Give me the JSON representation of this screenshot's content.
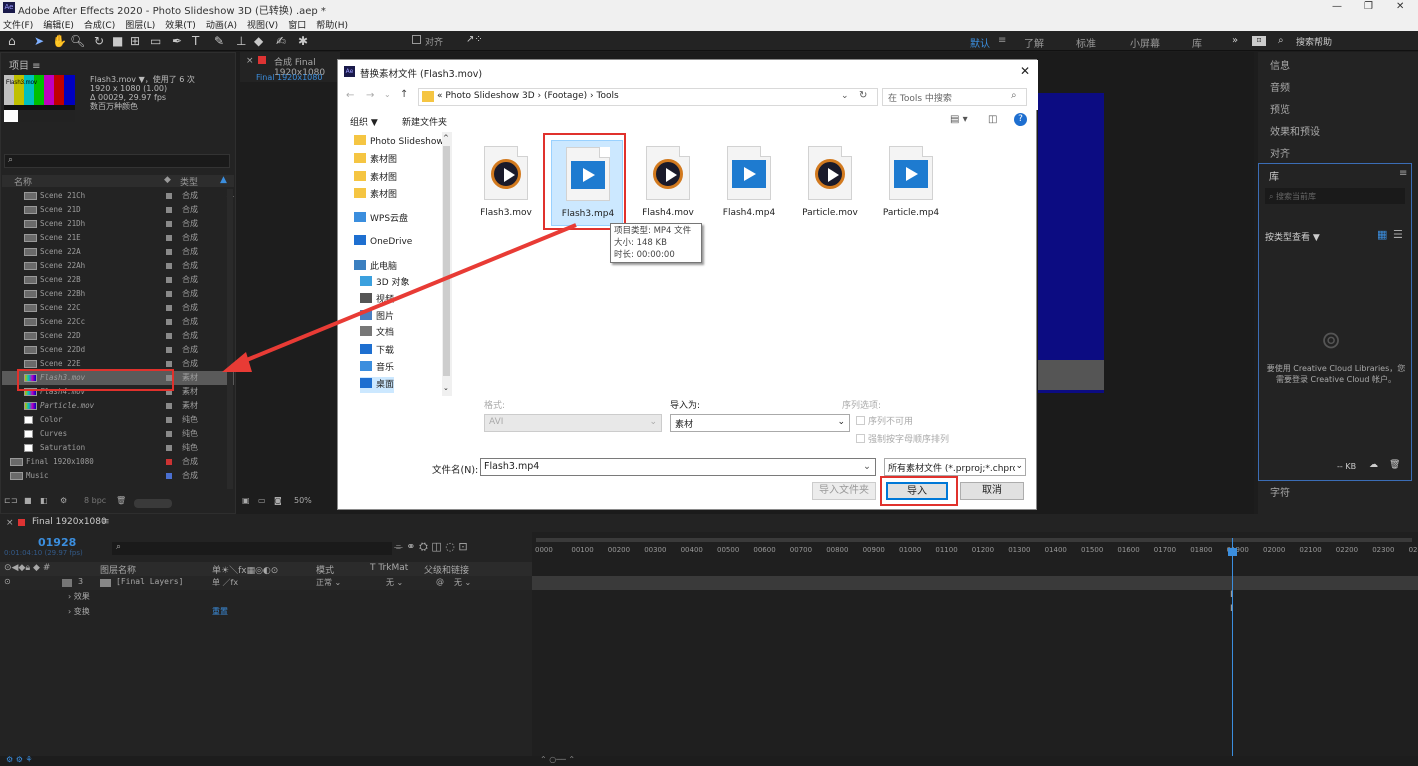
{
  "app": {
    "title": "Adobe After Effects 2020 - Photo Slideshow 3D (已转换) .aep *",
    "logo": "Ae"
  },
  "menu": [
    "文件(F)",
    "编辑(E)",
    "合成(C)",
    "图层(L)",
    "效果(T)",
    "动画(A)",
    "视图(V)",
    "窗口",
    "帮助(H)"
  ],
  "toolbar": {
    "align_label": "对齐",
    "workspaces": [
      "默认",
      "了解",
      "标准",
      "小屏幕",
      "库"
    ],
    "workspace_active": "默认",
    "search_help": "搜索帮助"
  },
  "project": {
    "title": "项目",
    "selected_name": "Flash3.mov",
    "selected_info": [
      "Flash3.mov ▼，使用了 6 次",
      "1920 x 1080 (1.00)",
      "Δ 00029, 29.97 fps",
      "数百万种颜色"
    ],
    "col_name": "名称",
    "col_type": "类型",
    "bpc": "8 bpc",
    "rows": [
      {
        "name": "Scene 21Ch",
        "type": "合成"
      },
      {
        "name": "Scene 21D",
        "type": "合成"
      },
      {
        "name": "Scene 21Dh",
        "type": "合成"
      },
      {
        "name": "Scene 21E",
        "type": "合成"
      },
      {
        "name": "Scene 22A",
        "type": "合成"
      },
      {
        "name": "Scene 22Ah",
        "type": "合成"
      },
      {
        "name": "Scene 22B",
        "type": "合成"
      },
      {
        "name": "Scene 22Bh",
        "type": "合成"
      },
      {
        "name": "Scene 22C",
        "type": "合成"
      },
      {
        "name": "Scene 22Cc",
        "type": "合成"
      },
      {
        "name": "Scene 22D",
        "type": "合成"
      },
      {
        "name": "Scene 22Dd",
        "type": "合成"
      },
      {
        "name": "Scene 22E",
        "type": "合成"
      },
      {
        "name": "Flash3.mov",
        "type": "素材"
      },
      {
        "name": "Flash4.mov",
        "type": "素材"
      },
      {
        "name": "Particle.mov",
        "type": "素材"
      },
      {
        "name": "Color",
        "type": "纯色"
      },
      {
        "name": "Curves",
        "type": "纯色"
      },
      {
        "name": "Saturation",
        "type": "纯色"
      },
      {
        "name": "Final 1920x1080",
        "type": "合成"
      },
      {
        "name": "Music",
        "type": "合成"
      }
    ]
  },
  "comp": {
    "tab": "合成 Final 1920x1080",
    "subtab": "Final 1920x1080",
    "zoom": "50%"
  },
  "right_panels": {
    "items": [
      "信息",
      "音频",
      "预览",
      "效果和预设",
      "对齐"
    ],
    "library": "库",
    "library_search": "搜索当前库",
    "library_view": "按类型查看",
    "cc_message": "要使用 Creative Cloud Libraries，您需要登录 Creative Cloud 帐户。",
    "kb": "-- KB",
    "char": "字符"
  },
  "dialog": {
    "title": "替换素材文件 (Flash3.mov)",
    "path": [
      "Photo Slideshow 3D",
      "(Footage)",
      "Tools"
    ],
    "search_placeholder": "在 Tools 中搜索",
    "organize": "组织 ▼",
    "new_folder": "新建文件夹",
    "nav": [
      "Photo Slideshow",
      "素材图",
      "素材图",
      "素材图",
      "WPS云盘",
      "OneDrive",
      "此电脑",
      "3D 对象",
      "视频",
      "图片",
      "文档",
      "下载",
      "音乐",
      "桌面"
    ],
    "files": [
      {
        "name": "Flash3.mov",
        "kind": "mov"
      },
      {
        "name": "Flash3.mp4",
        "kind": "mp4"
      },
      {
        "name": "Flash4.mov",
        "kind": "mov"
      },
      {
        "name": "Flash4.mp4",
        "kind": "mp4"
      },
      {
        "name": "Particle.mov",
        "kind": "mov"
      },
      {
        "name": "Particle.mp4",
        "kind": "mp4"
      }
    ],
    "tooltip": [
      "项目类型: MP4 文件",
      "大小: 148 KB",
      "时长: 00:00:00"
    ],
    "format_label": "格式:",
    "format_value": "AVI",
    "import_as_label": "导入为:",
    "import_as_value": "素材",
    "seq_label": "序列选项:",
    "seq_unavailable": "序列不可用",
    "seq_alpha": "强制按字母顺序排列",
    "filename_label": "文件名(N):",
    "filename": "Flash3.mp4",
    "filetype": "所有素材文件 (*.prproj;*.chpro",
    "import_folder": "导入文件夹",
    "import": "导入",
    "cancel": "取消"
  },
  "timeline": {
    "tab": "Final 1920x1080",
    "timecode": "01928",
    "timecode_sub": "0:01:04:10 (29.97 fps)",
    "col_layer": "图层名称",
    "col_mode": "模式",
    "col_trk": "T TrkMat",
    "col_parent": "父级和链接",
    "layer_num": "3",
    "layer_name": "[Final Layers]",
    "mode": "正常",
    "trk": "无",
    "parent": "无",
    "sub1": "效果",
    "sub2": "变换",
    "reset": "重置",
    "ruler": [
      "0000",
      "00100",
      "00200",
      "00300",
      "00400",
      "00500",
      "00600",
      "00700",
      "00800",
      "00900",
      "01000",
      "01100",
      "01200",
      "01300",
      "01400",
      "01500",
      "01600",
      "01700",
      "01800",
      "01900",
      "02000",
      "02100",
      "02200",
      "02300",
      "0240"
    ]
  }
}
